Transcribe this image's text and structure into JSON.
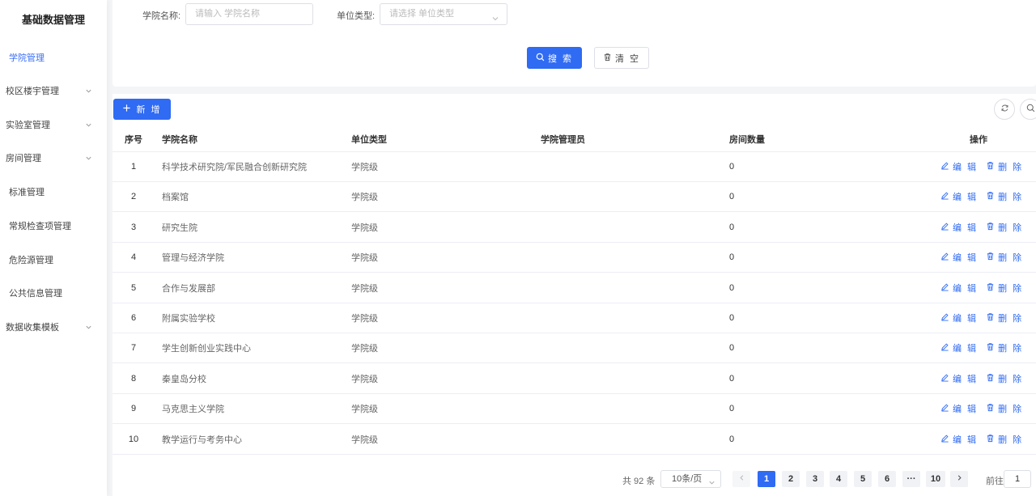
{
  "sidebar": {
    "title": "基础数据管理",
    "items": [
      {
        "label": "学院管理",
        "active": true,
        "expandable": false
      },
      {
        "label": "校区楼宇管理",
        "active": false,
        "expandable": true
      },
      {
        "label": "实验室管理",
        "active": false,
        "expandable": true
      },
      {
        "label": "房间管理",
        "active": false,
        "expandable": true
      },
      {
        "label": "标准管理",
        "active": false,
        "expandable": false
      },
      {
        "label": "常规检查项管理",
        "active": false,
        "expandable": false
      },
      {
        "label": "危险源管理",
        "active": false,
        "expandable": false
      },
      {
        "label": "公共信息管理",
        "active": false,
        "expandable": false
      },
      {
        "label": "数据收集模板",
        "active": false,
        "expandable": true
      }
    ]
  },
  "filters": {
    "college_label": "学院名称:",
    "college_placeholder": "请输入 学院名称",
    "unit_type_label": "单位类型:",
    "unit_type_placeholder": "请选择 单位类型",
    "search_label": "搜 索",
    "clear_label": "清 空"
  },
  "toolbar": {
    "add_label": "新 增"
  },
  "table": {
    "columns": [
      "序号",
      "学院名称",
      "单位类型",
      "学院管理员",
      "房间数量",
      "操作"
    ],
    "rows": [
      {
        "index": "1",
        "name": "科学技术研究院/军民融合创新研究院",
        "type": "学院级",
        "admin": "",
        "rooms": "0"
      },
      {
        "index": "2",
        "name": "档案馆",
        "type": "学院级",
        "admin": "",
        "rooms": "0"
      },
      {
        "index": "3",
        "name": "研究生院",
        "type": "学院级",
        "admin": "",
        "rooms": "0"
      },
      {
        "index": "4",
        "name": "管理与经济学院",
        "type": "学院级",
        "admin": "",
        "rooms": "0"
      },
      {
        "index": "5",
        "name": "合作与发展部",
        "type": "学院级",
        "admin": "",
        "rooms": "0"
      },
      {
        "index": "6",
        "name": "附属实验学校",
        "type": "学院级",
        "admin": "",
        "rooms": "0"
      },
      {
        "index": "7",
        "name": "学生创新创业实践中心",
        "type": "学院级",
        "admin": "",
        "rooms": "0"
      },
      {
        "index": "8",
        "name": "秦皇岛分校",
        "type": "学院级",
        "admin": "",
        "rooms": "0"
      },
      {
        "index": "9",
        "name": "马克思主义学院",
        "type": "学院级",
        "admin": "",
        "rooms": "0"
      },
      {
        "index": "10",
        "name": "教学运行与考务中心",
        "type": "学院级",
        "admin": "",
        "rooms": "0"
      }
    ],
    "edit_label": "编 辑",
    "delete_label": "删 除"
  },
  "pagination": {
    "total_text": "共 92 条",
    "page_size": "10条/页",
    "pages": [
      "1",
      "2",
      "3",
      "4",
      "5",
      "6",
      "···",
      "10"
    ],
    "current_page": "1",
    "goto_label": "前往",
    "goto_value": "1"
  },
  "colors": {
    "primary": "#2f6bf3",
    "active_menu": "#3b6ff5"
  }
}
